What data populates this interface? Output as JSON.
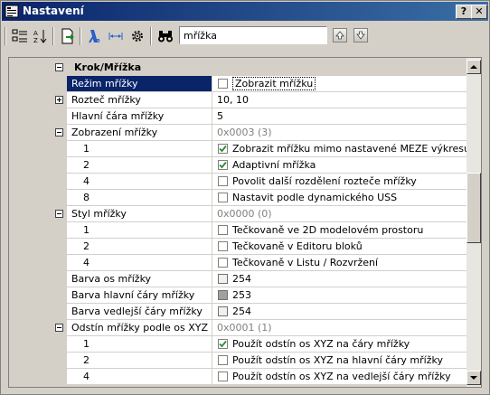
{
  "window": {
    "title": "Nastavení"
  },
  "titlebar": {
    "help_label": "?",
    "close_label": "✕"
  },
  "toolbar": {
    "search_value": "mřížka",
    "icons": [
      "tree-view-icon",
      "sort-az-icon",
      "export-icon",
      "filter-icon",
      "width-icon",
      "settings-gear-icon",
      "binoculars-icon",
      "up-arrow-icon",
      "down-arrow-icon"
    ]
  },
  "category": {
    "label": "Krok/Mřížka"
  },
  "rows": [
    {
      "kind": "prop",
      "name": "Režim mřížky",
      "value_type": "checkbox",
      "checked": false,
      "value": "Zobrazit mřížku",
      "selected": true
    },
    {
      "kind": "prop",
      "name": "Rozteč mřížky",
      "value_type": "text",
      "value": "10, 10",
      "expander": "plus"
    },
    {
      "kind": "prop",
      "name": "Hlavní čára mřížky",
      "value_type": "text",
      "value": "5"
    },
    {
      "kind": "prop",
      "name": "Zobrazení mřížky",
      "value_type": "summary",
      "value": "0x0003 (3)",
      "expander": "minus"
    },
    {
      "kind": "sub",
      "name": "1",
      "value_type": "checkbox",
      "checked": true,
      "value": "Zobrazit mřížku mimo nastavené MEZE výkresu"
    },
    {
      "kind": "sub",
      "name": "2",
      "value_type": "checkbox",
      "checked": true,
      "value": "Adaptivní mřížka"
    },
    {
      "kind": "sub",
      "name": "4",
      "value_type": "checkbox",
      "checked": false,
      "value": "Povolit další rozdělení rozteče mřížky"
    },
    {
      "kind": "sub",
      "name": "8",
      "value_type": "checkbox",
      "checked": false,
      "value": "Nastavit podle dynamického USS"
    },
    {
      "kind": "prop",
      "name": "Styl mřížky",
      "value_type": "summary",
      "value": "0x0000 (0)",
      "expander": "minus"
    },
    {
      "kind": "sub",
      "name": "1",
      "value_type": "checkbox",
      "checked": false,
      "value": "Tečkovaně ve 2D modelovém prostoru"
    },
    {
      "kind": "sub",
      "name": "2",
      "value_type": "checkbox",
      "checked": false,
      "value": "Tečkovaně v Editoru bloků"
    },
    {
      "kind": "sub",
      "name": "4",
      "value_type": "checkbox",
      "checked": false,
      "value": "Tečkovaně v Listu / Rozvržení"
    },
    {
      "kind": "prop",
      "name": "Barva os mřížky",
      "value_type": "color",
      "swatch": "#f0f0f0",
      "value": "254"
    },
    {
      "kind": "prop",
      "name": "Barva hlavní čáry mřížky",
      "value_type": "color",
      "swatch": "#a0a0a0",
      "value": "253"
    },
    {
      "kind": "prop",
      "name": "Barva vedlejší čáry mřížky",
      "value_type": "color",
      "swatch": "#f0f0f0",
      "value": "254"
    },
    {
      "kind": "prop",
      "name": "Odstín mřížky podle os XYZ",
      "value_type": "summary",
      "value": "0x0001 (1)",
      "expander": "minus"
    },
    {
      "kind": "sub",
      "name": "1",
      "value_type": "checkbox",
      "checked": true,
      "value": "Použít odstín os XYZ na čáry mřížky"
    },
    {
      "kind": "sub",
      "name": "2",
      "value_type": "checkbox",
      "checked": false,
      "value": "Použít odstín os XYZ na hlavní čáry mřížky"
    },
    {
      "kind": "sub",
      "name": "4",
      "value_type": "checkbox",
      "checked": false,
      "value": "Použít odstín os XYZ na vedlejší čáry mřížky"
    }
  ],
  "colors": {
    "title_start": "#0a246a",
    "title_end": "#3a6ea5",
    "selection": "#0a246a",
    "check": "#2e8b2e"
  }
}
